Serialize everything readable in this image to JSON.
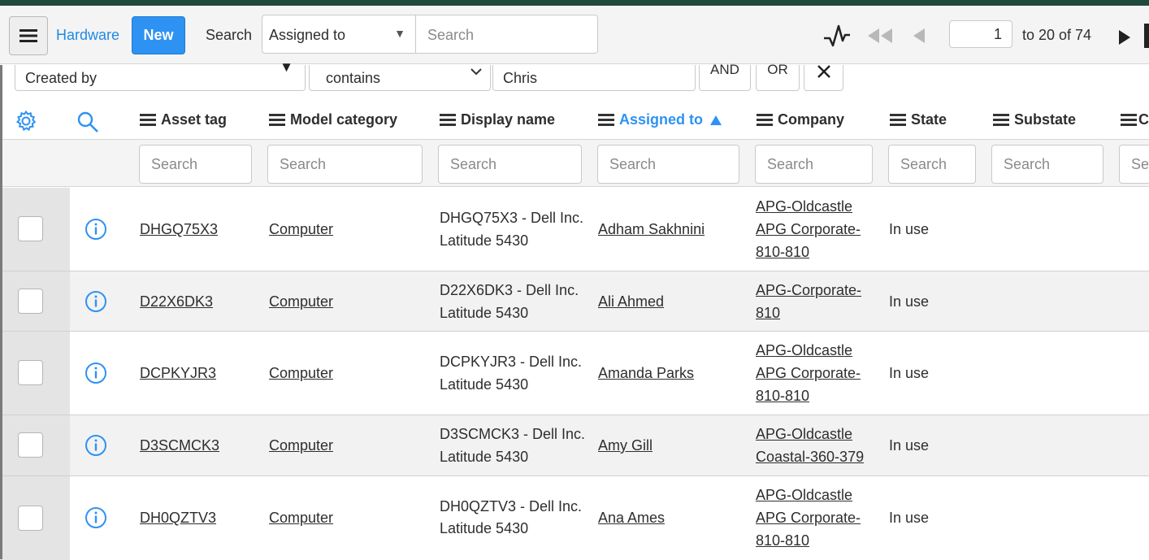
{
  "header": {
    "title": "Hardware",
    "new_label": "New",
    "search_label": "Search",
    "search_field": "Assigned to",
    "search_placeholder": "Search",
    "page_input": "1",
    "page_count": "to 20 of 74"
  },
  "filter": {
    "field": "Created by",
    "operator": "contains",
    "value": "Chris",
    "and_label": "AND",
    "or_label": "OR"
  },
  "columns": [
    {
      "label": "Asset tag"
    },
    {
      "label": "Model category"
    },
    {
      "label": "Display name"
    },
    {
      "label": "Assigned to",
      "sort": "ascending"
    },
    {
      "label": "Company"
    },
    {
      "label": "State"
    },
    {
      "label": "Substate"
    },
    {
      "label": "C"
    }
  ],
  "column_search_placeholder": "Search",
  "column_search_placeholder_partial": "Sea",
  "rows": [
    {
      "asset_tag": "DHGQ75X3",
      "model_category": "Computer",
      "display_name_1": "DHGQ75X3 - Dell Inc.",
      "display_name_2": "Latitude 5430",
      "assigned_to": "Adham Sakhnini",
      "company_1": "APG-Oldcastle",
      "company_2": "APG Corporate-",
      "company_3": "810-810",
      "state": "In use"
    },
    {
      "asset_tag": "D22X6DK3",
      "model_category": "Computer",
      "display_name_1": "D22X6DK3 - Dell Inc.",
      "display_name_2": "Latitude 5430",
      "assigned_to": "Ali Ahmed",
      "company_1": "APG-Corporate-",
      "company_2": "810",
      "company_3": "",
      "state": "In use"
    },
    {
      "asset_tag": "DCPKYJR3",
      "model_category": "Computer",
      "display_name_1": "DCPKYJR3 - Dell Inc.",
      "display_name_2": "Latitude 5430",
      "assigned_to": "Amanda Parks",
      "company_1": "APG-Oldcastle",
      "company_2": "APG Corporate-",
      "company_3": "810-810",
      "state": "In use"
    },
    {
      "asset_tag": "D3SCMCK3",
      "model_category": "Computer",
      "display_name_1": "D3SCMCK3 - Dell Inc.",
      "display_name_2": "Latitude 5430",
      "assigned_to": "Amy Gill",
      "company_1": "APG-Oldcastle",
      "company_2": "Coastal-360-379",
      "company_3": "",
      "state": "In use"
    },
    {
      "asset_tag": "DH0QZTV3",
      "model_category": "Computer",
      "display_name_1": "DH0QZTV3 - Dell Inc.",
      "display_name_2": "Latitude 5430",
      "assigned_to": "Ana Ames",
      "company_1": "APG-Oldcastle",
      "company_2": "APG Corporate-",
      "company_3": "810-810",
      "state": "In use"
    }
  ],
  "colors": {
    "accent": "#2e92f2",
    "header_bg": "#f4f4f4",
    "top_stripe": "#1f4a3c"
  }
}
